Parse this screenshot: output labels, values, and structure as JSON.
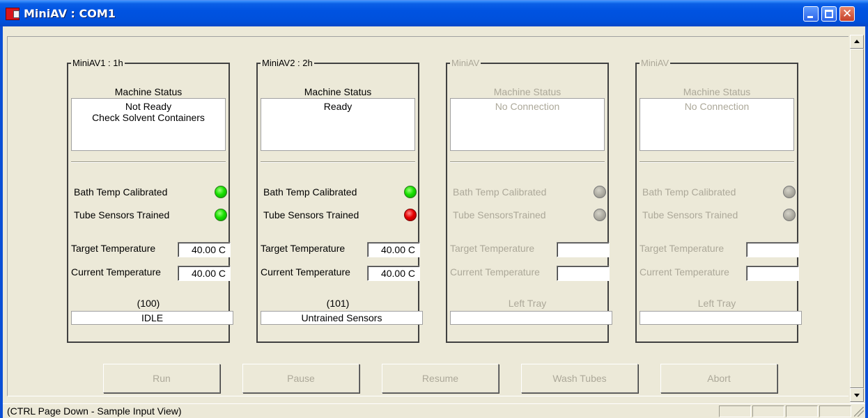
{
  "window": {
    "title": "MiniAV : COM1",
    "minimize_icon": "minimize-icon",
    "maximize_icon": "maximize-icon",
    "close_icon": "close-icon"
  },
  "panels": [
    {
      "title": "MiniAV1 : 1h",
      "status_title": "Machine Status",
      "status_lines": [
        "Not Ready",
        "Check Solvent Containers"
      ],
      "flag1_label": "Bath Temp Calibrated",
      "flag1_state": "green",
      "flag2_label": "Tube Sensors Trained",
      "flag2_state": "green",
      "target_label": "Target Temperature",
      "target_value": "40.00 C",
      "current_label": "Current Temperature",
      "current_value": "40.00 C",
      "tray_label": "(100)",
      "tray_value": "IDLE"
    },
    {
      "title": "MiniAV2 : 2h",
      "status_title": "Machine Status",
      "status_lines": [
        "Ready",
        ""
      ],
      "flag1_label": "Bath Temp Calibrated",
      "flag1_state": "green",
      "flag2_label": "Tube Sensors Trained",
      "flag2_state": "red",
      "target_label": "Target Temperature",
      "target_value": "40.00 C",
      "current_label": "Current Temperature",
      "current_value": "40.00 C",
      "tray_label": "(101)",
      "tray_value": "Untrained Sensors"
    },
    {
      "title": "MiniAV",
      "status_title": "Machine Status",
      "status_lines": [
        "No Connection",
        ""
      ],
      "flag1_label": "Bath Temp Calibrated",
      "flag1_state": "gray",
      "flag2_label": "Tube SensorsTrained",
      "flag2_state": "gray",
      "target_label": "Target Temperature",
      "target_value": "",
      "current_label": "Current Temperature",
      "current_value": "",
      "tray_label": "Left Tray",
      "tray_value": ""
    },
    {
      "title": "MiniAV",
      "status_title": "Machine Status",
      "status_lines": [
        "No Connection",
        ""
      ],
      "flag1_label": "Bath Temp Calibrated",
      "flag1_state": "gray",
      "flag2_label": "Tube Sensors Trained",
      "flag2_state": "gray",
      "target_label": "Target Temperature",
      "target_value": "",
      "current_label": "Current Temperature",
      "current_value": "",
      "tray_label": "Left Tray",
      "tray_value": ""
    }
  ],
  "buttons": {
    "run": "Run",
    "pause": "Pause",
    "resume": "Resume",
    "wash": "Wash Tubes",
    "abort": "Abort"
  },
  "statusbar": {
    "text": "(CTRL Page Down - Sample Input View)"
  }
}
